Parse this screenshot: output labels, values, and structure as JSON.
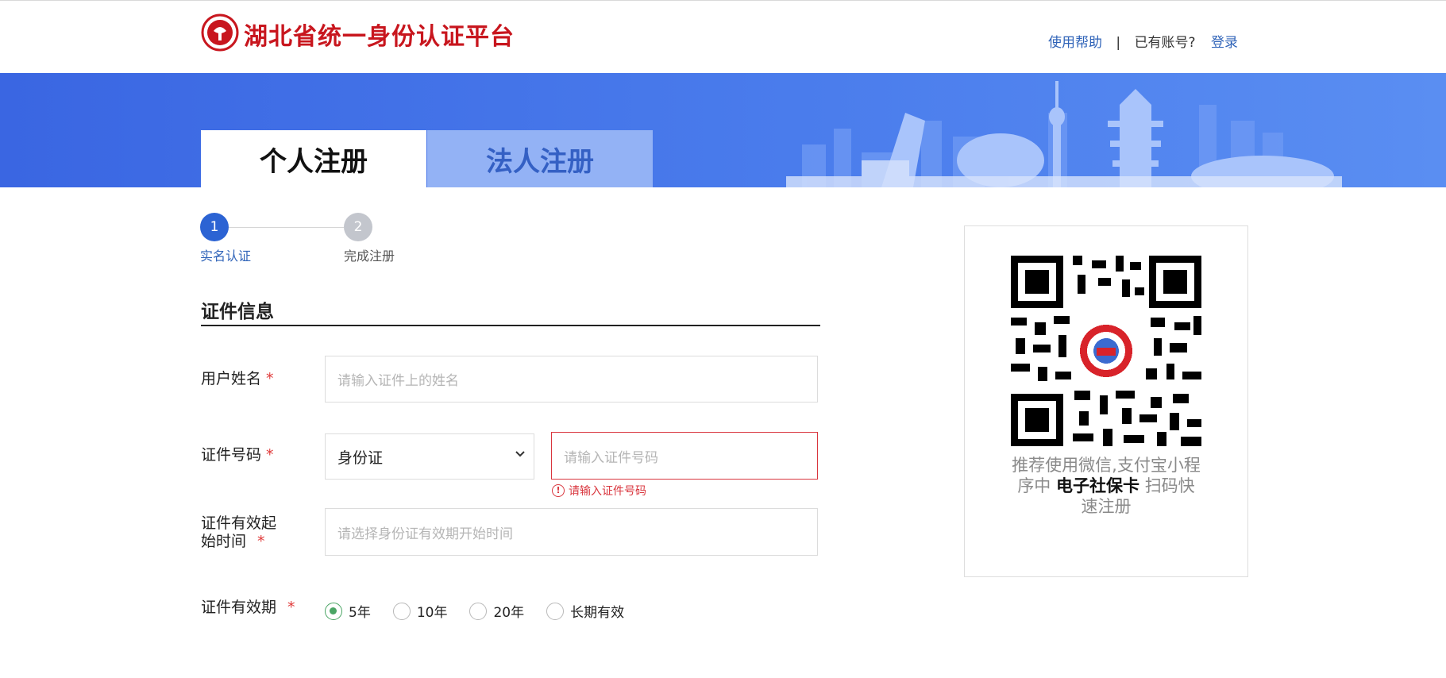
{
  "header": {
    "brand": "湖北省统一身份认证平台",
    "help_link": "使用帮助",
    "separator": "|",
    "have_account": "已有账号?",
    "login_link": "登录"
  },
  "tabs": [
    {
      "label": "个人注册",
      "active": true
    },
    {
      "label": "法人注册",
      "active": false
    }
  ],
  "steps": [
    {
      "number": "1",
      "label": "实名认证",
      "active": true
    },
    {
      "number": "2",
      "label": "完成注册",
      "active": false
    }
  ],
  "section": {
    "title": "证件信息"
  },
  "form": {
    "name": {
      "label": "用户姓名",
      "required": "*",
      "placeholder": "请输入证件上的姓名"
    },
    "id_number": {
      "label": "证件号码",
      "required": "*",
      "doc_type": "身份证",
      "placeholder": "请输入证件号码",
      "error": "请输入证件号码"
    },
    "valid_start": {
      "label_line1": "证件有效起",
      "label_line2": "始时间",
      "required": "*",
      "placeholder": "请选择身份证有效期开始时间"
    },
    "validity": {
      "label": "证件有效期",
      "required": "*",
      "options": [
        "5年",
        "10年",
        "20年",
        "长期有效"
      ],
      "selected": "5年"
    }
  },
  "qr_panel": {
    "caption_part1": "推荐使用微信,支付宝小程序中",
    "caption_bold": "电子社保卡",
    "caption_part2": "扫码快速注册"
  },
  "colors": {
    "brand_red": "#c8161e",
    "link_blue": "#2f63b8",
    "banner_blue": "#3a66e2",
    "step_active": "#2c63d3",
    "error_red": "#d9363e",
    "radio_green": "#4aa564"
  }
}
